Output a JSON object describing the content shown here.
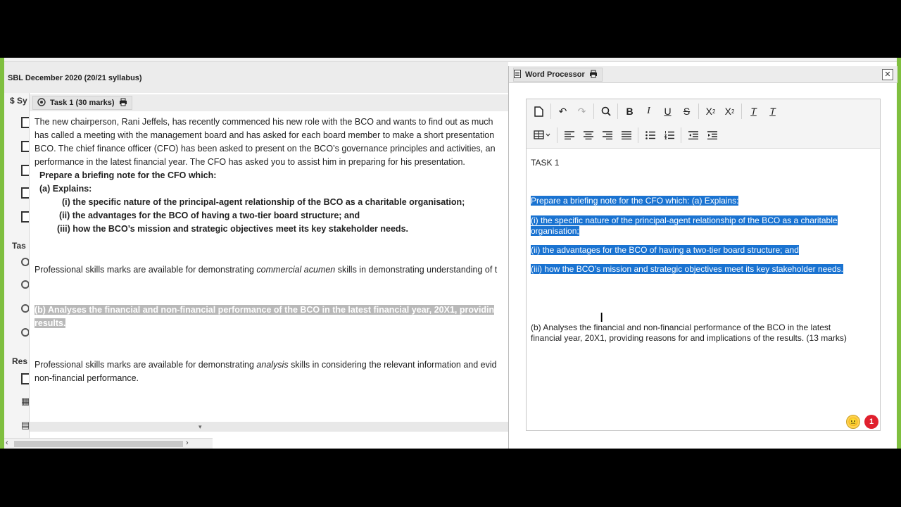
{
  "exam": {
    "title": "SBL December 2020 (20/21 syllabus)"
  },
  "sidebar": {
    "top_label": "$  Sy",
    "tasks_label": "Tas",
    "resources_label": "Res"
  },
  "task_panel": {
    "tab_label": "Task 1 (30 marks)",
    "intro_lines": [
      "The new chairperson, Rani Jeffels, has recently commenced his new role with the BCO and wants to find out as much",
      "has called a meeting with the management board and has asked for each board member to make a short presentation",
      "BCO. The chief finance officer (CFO) has been asked to present on the BCO’s governance principles and activities, an",
      "performance in the latest financial year. The CFO has asked you to assist him in preparing for his presentation."
    ],
    "prepare": "Prepare a briefing note for the CFO which:",
    "a_explains": "(a) Explains:",
    "item_i": "(i) the specific nature of the principal-agent relationship of the BCO as a charitable organisation;",
    "item_ii": "(ii) the advantages for the BCO of having a two-tier board structure; and",
    "item_iii": "(iii) how the BCO’s mission and strategic objectives meet its key stakeholder needs.",
    "ps1_before": "Professional skills marks are available for demonstrating ",
    "ps1_em": "commercial acumen",
    "ps1_after": " skills in demonstrating understanding of t",
    "b_line1": "(b) Analyses the financial and non-financial performance of the BCO in the latest financial year, 20X1, providin",
    "b_line2": "results.",
    "ps2_before": "Professional skills marks are available for demonstrating ",
    "ps2_em": "analysis",
    "ps2_after": " skills in considering the relevant information and evid",
    "ps2_line2": "non-financial performance."
  },
  "word_processor": {
    "title": "Word Processor",
    "close_icon": "close-icon",
    "toolbar_icons": [
      "new-document-icon",
      "undo-icon",
      "redo-icon",
      "find-icon",
      "bold-icon",
      "italic-icon",
      "underline-icon",
      "strikethrough-icon",
      "subscript-icon",
      "superscript-icon",
      "clear-format-icon",
      "remove-format-icon",
      "table-icon",
      "align-left-icon",
      "align-center-icon",
      "align-right-icon",
      "justify-icon",
      "bullet-list-icon",
      "numbered-list-icon",
      "outdent-icon",
      "indent-icon"
    ],
    "doc": {
      "heading": "TASK 1",
      "sel1": "Prepare a briefing note for the CFO which: (a) Explains:",
      "sel2a": "(i) the specific nature of the principal-agent relationship of the BCO as a charitable",
      "sel2b": "organisation;",
      "sel3": "(ii) the advantages for the BCO of having a two-tier board structure; and",
      "sel4": "(iii) how the BCO’s mission and strategic objectives meet its key stakeholder needs.",
      "b1": "(b) Analyses the financial and non-financial performance of the BCO in the latest",
      "b2": "financial year, 20X1, providing reasons for and implications of the results. (13 marks)"
    },
    "emoji": "😐",
    "notification_count": "1"
  },
  "colors": {
    "frame": "#7fbf3f",
    "selection": "#1a73d1",
    "badge": "#e0202e"
  }
}
